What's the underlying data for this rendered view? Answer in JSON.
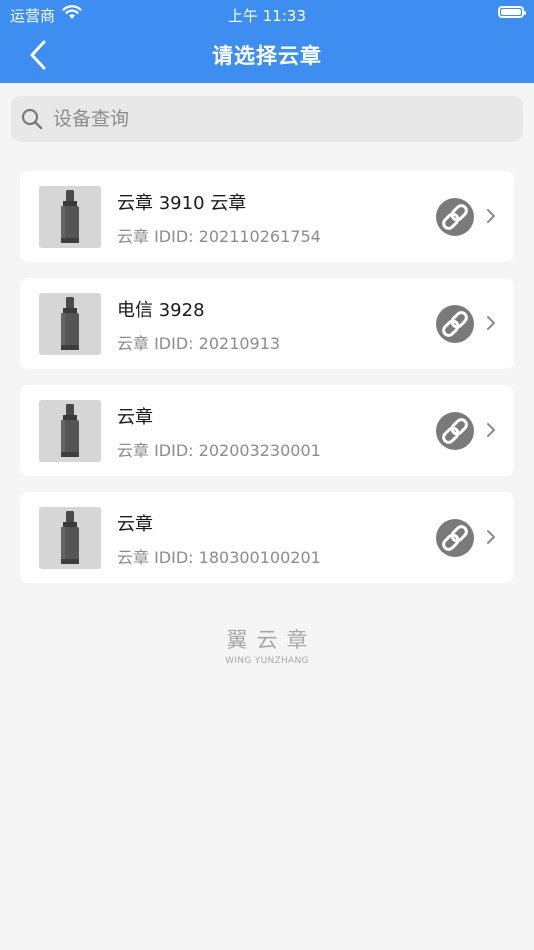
{
  "status_bar": {
    "carrier": "运营商",
    "time": "上午 11:33"
  },
  "nav": {
    "title": "请选择云章",
    "back_icon": "chevron-left-icon"
  },
  "search": {
    "placeholder": "设备查询",
    "icon": "search-icon"
  },
  "devices": [
    {
      "name": "云章 3910 云章",
      "id_label": "云章 IDID:",
      "id_value": "202110261754"
    },
    {
      "name": "电信 3928",
      "id_label": "云章 IDID:",
      "id_value": "20210913"
    },
    {
      "name": "云章",
      "id_label": "云章 IDID:",
      "id_value": "202003230001"
    },
    {
      "name": "云章",
      "id_label": "云章 IDID:",
      "id_value": "180300100201"
    }
  ],
  "footer": {
    "brand_cn": "翼云章",
    "brand_en": "WING YUNZHANG"
  },
  "colors": {
    "header": "#3d8ef0",
    "background": "#f5f5f5",
    "link_badge": "#7a7a7a"
  }
}
